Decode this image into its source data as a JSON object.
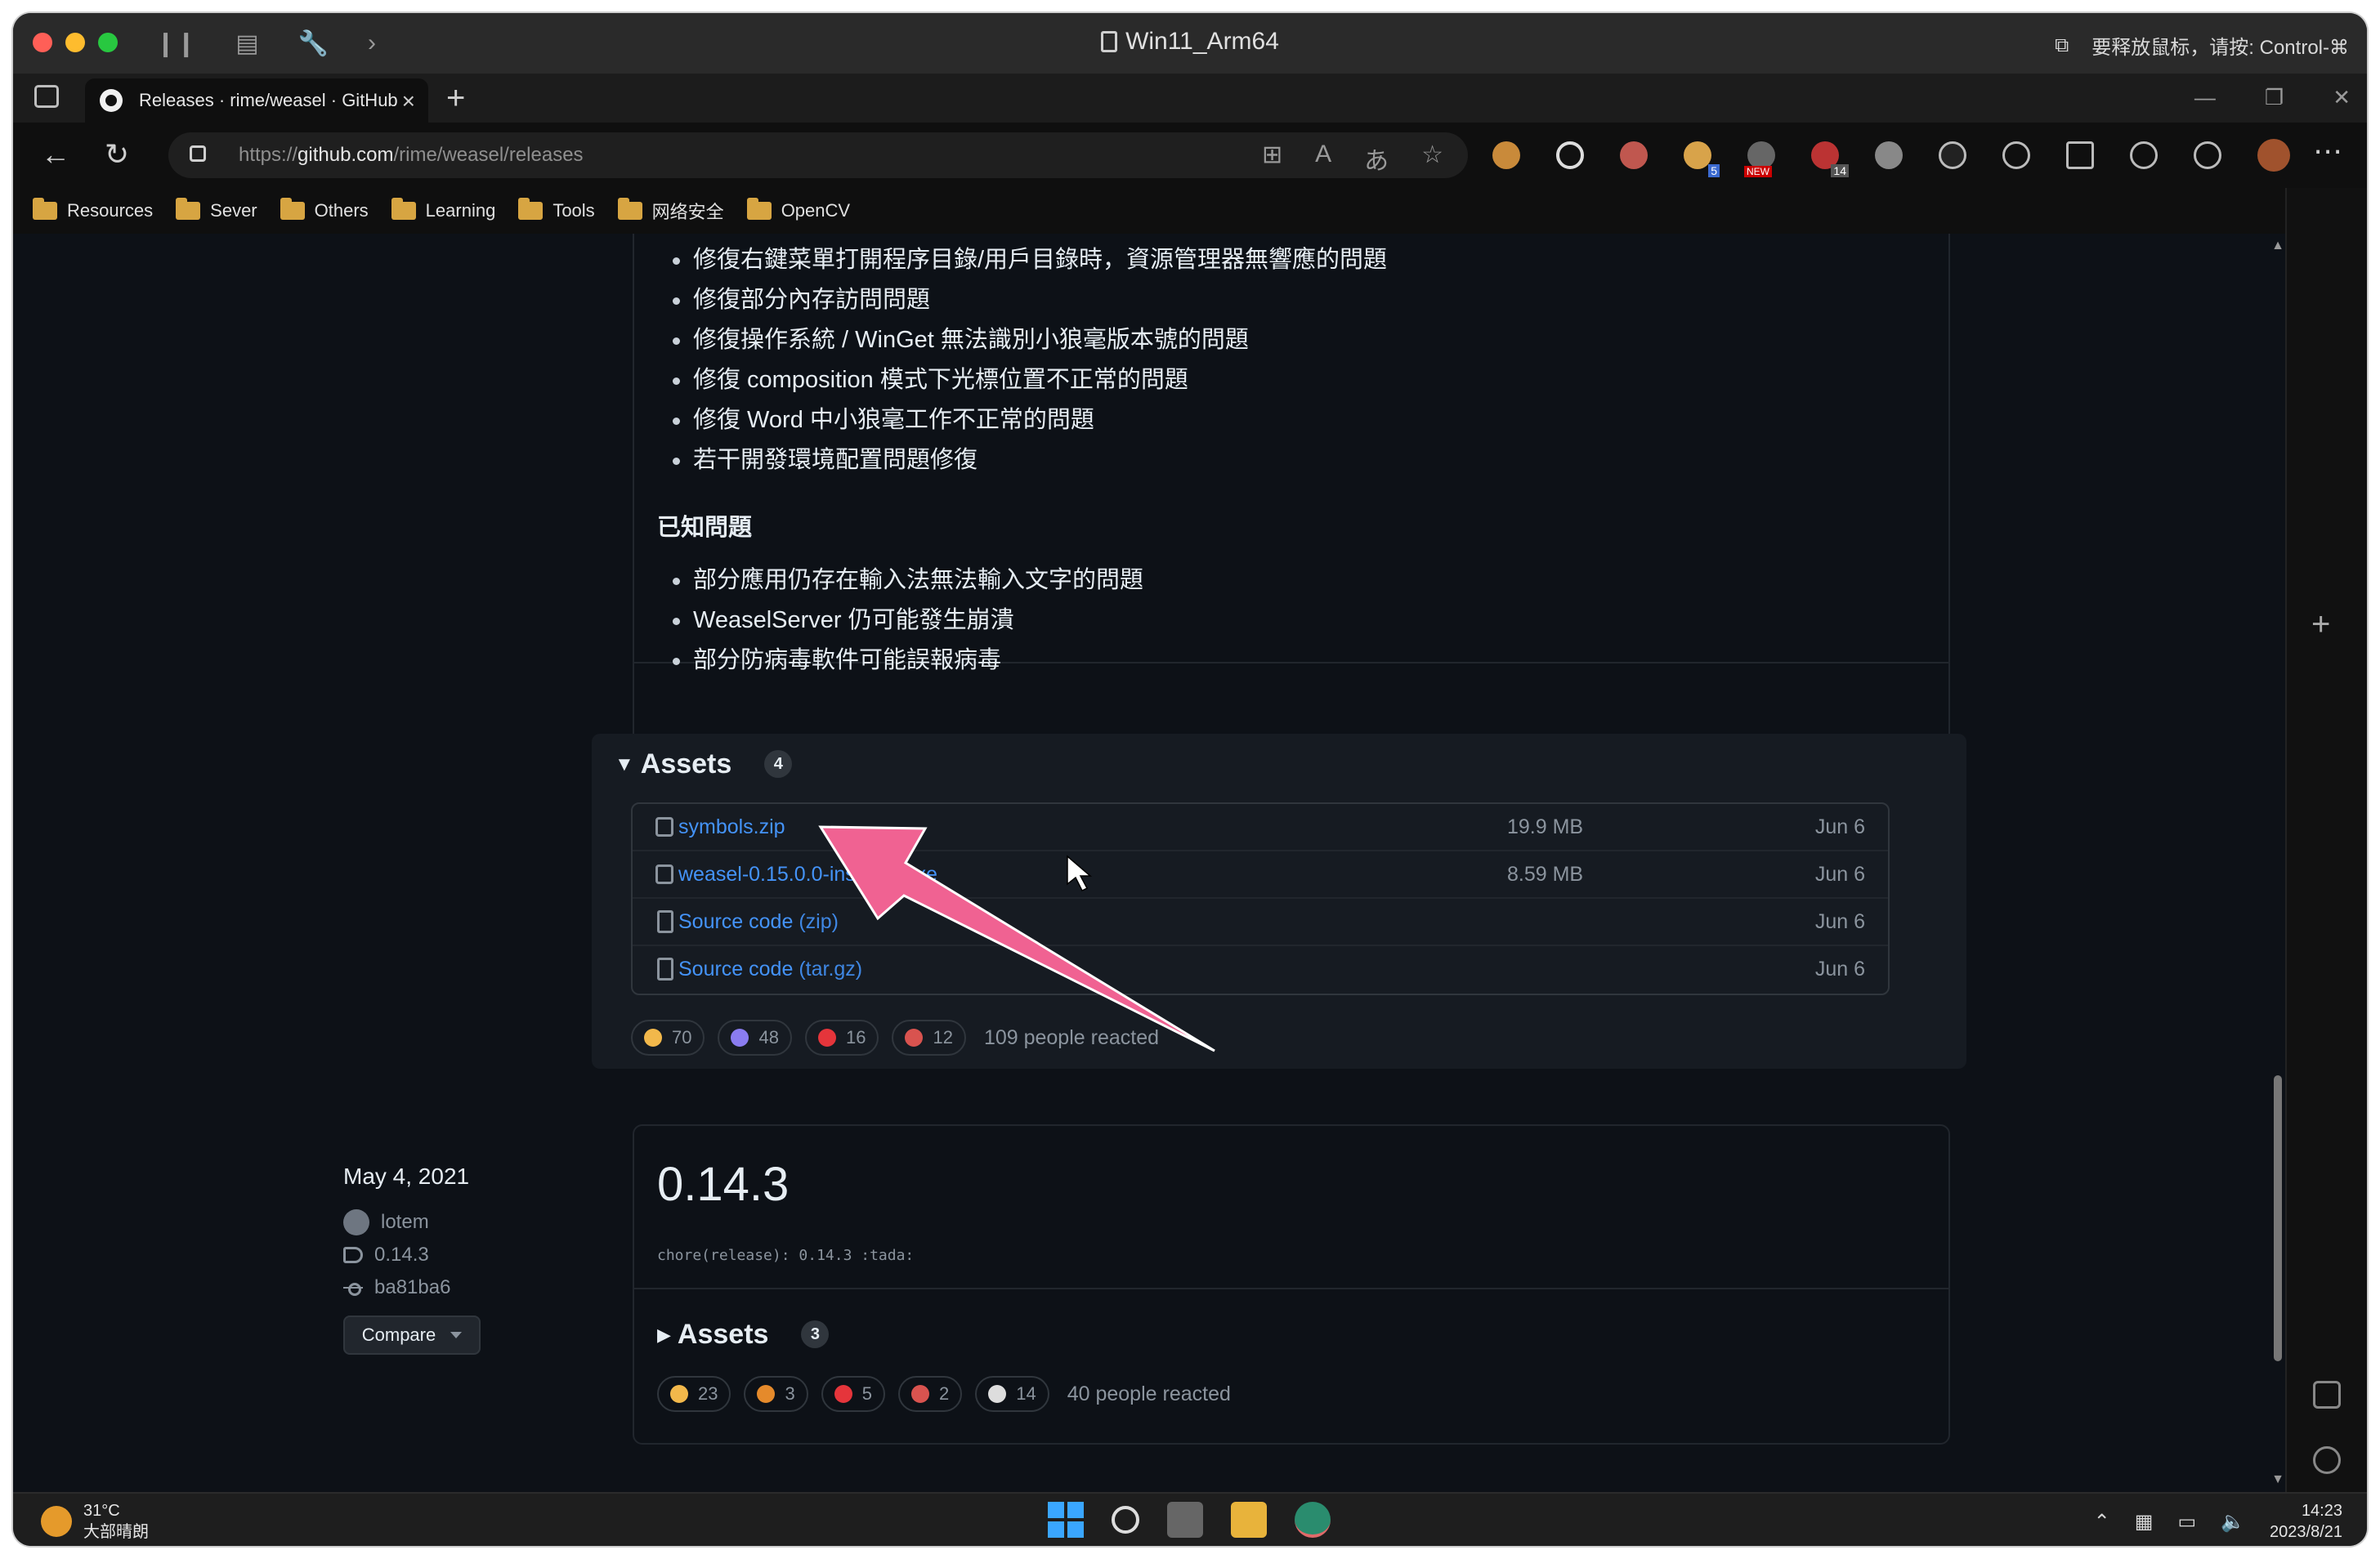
{
  "window": {
    "title": "Win11_Arm64",
    "release_hint": "要释放鼠标，请按: Control-⌘"
  },
  "browser": {
    "tab_title": "Releases · rime/weasel · GitHub",
    "url_prefix": "https://",
    "url_domain": "github.com",
    "url_path": "/rime/weasel/releases",
    "ext_badges": [
      "5",
      "NEW",
      "14"
    ],
    "bookmarks": [
      "Resources",
      "Sever",
      "Others",
      "Learning",
      "Tools",
      "网络安全",
      "OpenCV"
    ]
  },
  "release1": {
    "fixes": [
      "修復右鍵菜單打開程序目錄/用戶目錄時，資源管理器無響應的問題",
      "修復部分內存訪問問題",
      "修復操作系統 / WinGet 無法識別小狼毫版本號的問題",
      "修復 composition 模式下光標位置不正常的問題",
      "修復 Word 中小狼毫工作不正常的問題",
      "若干開發環境配置問題修復"
    ],
    "known_heading": "已知問題",
    "known_issues": [
      "部分應用仍存在輸入法無法輸入文字的問題",
      "WeaselServer 仍可能發生崩潰",
      "部分防病毒軟件可能誤報病毒"
    ],
    "assets_title": "Assets",
    "assets_count": "4",
    "assets": [
      {
        "name": "symbols.zip",
        "suffix": "",
        "size": "19.9 MB",
        "date": "Jun 6",
        "icon": "package-icon"
      },
      {
        "name": "weasel-0.15.0.0-installer.exe",
        "suffix": "",
        "size": "8.59 MB",
        "date": "Jun 6",
        "icon": "package-icon"
      },
      {
        "name": "Source code",
        "suffix": "(zip)",
        "size": "",
        "date": "Jun 6",
        "icon": "file-zip-icon"
      },
      {
        "name": "Source code",
        "suffix": "(tar.gz)",
        "size": "",
        "date": "Jun 6",
        "icon": "file-zip-icon"
      }
    ],
    "reactions": [
      {
        "emoji": "thumbs-up",
        "count": "70",
        "color": "#f2b84b"
      },
      {
        "emoji": "party",
        "count": "48",
        "color": "#8a7cf0"
      },
      {
        "emoji": "heart",
        "count": "16",
        "color": "#e5353b"
      },
      {
        "emoji": "rocket",
        "count": "12",
        "color": "#d9534f"
      }
    ],
    "reacted_text": "109 people reacted"
  },
  "release2": {
    "date": "May 4, 2021",
    "author": "lotem",
    "tag": "0.14.3",
    "commit": "ba81ba6",
    "compare_label": "Compare",
    "version": "0.14.3",
    "commit_message": "chore(release): 0.14.3 :tada:",
    "assets_title": "Assets",
    "assets_count": "3",
    "reactions": [
      {
        "emoji": "thumbs-up",
        "count": "23",
        "color": "#f2b84b"
      },
      {
        "emoji": "smile",
        "count": "3",
        "color": "#e58a2b"
      },
      {
        "emoji": "heart",
        "count": "5",
        "color": "#e5353b"
      },
      {
        "emoji": "rocket",
        "count": "2",
        "color": "#d9534f"
      },
      {
        "emoji": "eyes",
        "count": "14",
        "color": "#dddddd"
      }
    ],
    "reacted_text": "40 people reacted"
  },
  "taskbar": {
    "temp": "31°C",
    "weather": "大部晴朗",
    "time": "14:23",
    "date": "2023/8/21"
  },
  "colors": {
    "link": "#4493f8",
    "annotation_arrow": "#f06292",
    "bg": "#0d1117"
  }
}
